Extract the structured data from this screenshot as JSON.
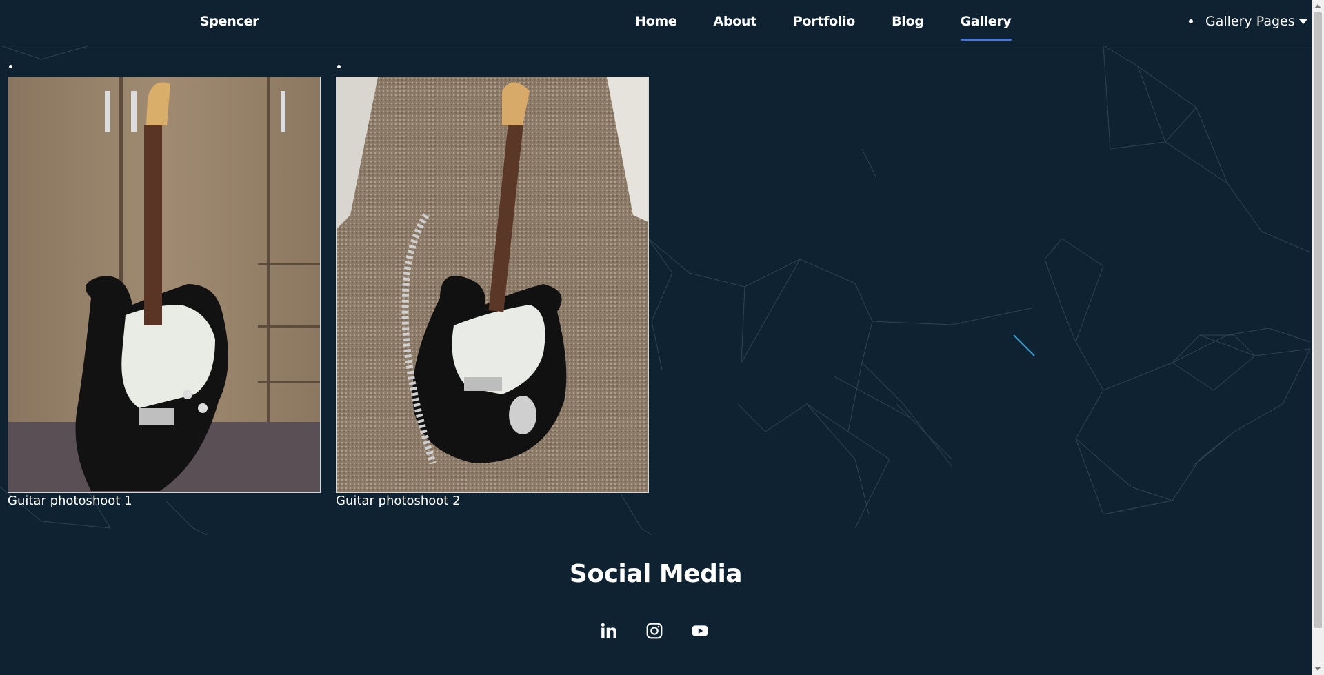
{
  "nav": {
    "brand": "Spencer",
    "links": [
      {
        "label": "Home",
        "active": false
      },
      {
        "label": "About",
        "active": false
      },
      {
        "label": "Portfolio",
        "active": false
      },
      {
        "label": "Blog",
        "active": false
      },
      {
        "label": "Gallery",
        "active": true
      }
    ],
    "dropdown_label": "Gallery Pages",
    "accent_color": "#4a74d9"
  },
  "gallery": {
    "items": [
      {
        "caption": "Guitar photoshoot 1",
        "image": "guitar-leaning-on-wardrobe"
      },
      {
        "caption": "Guitar photoshoot 2",
        "image": "guitar-on-carpet"
      }
    ]
  },
  "social": {
    "title": "Social Media",
    "icons": [
      "linkedin-icon",
      "instagram-icon",
      "youtube-icon"
    ]
  },
  "colors": {
    "background": "#0f2231",
    "text": "#ffffff"
  }
}
